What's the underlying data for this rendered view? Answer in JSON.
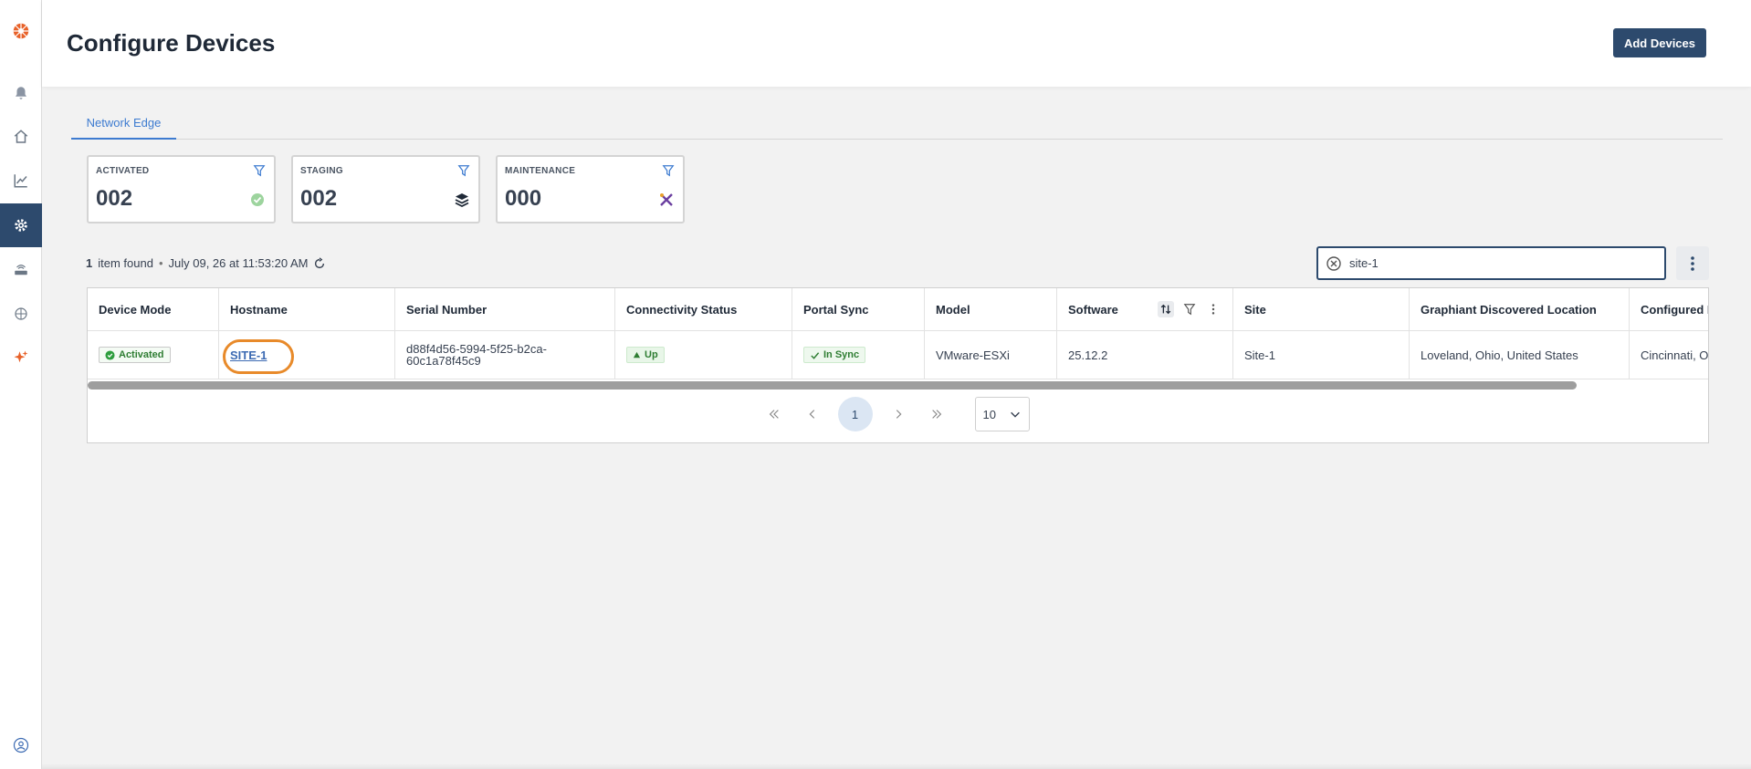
{
  "header": {
    "title": "Configure Devices",
    "add_button": "Add Devices"
  },
  "tabs": [
    {
      "label": "Network Edge",
      "active": true
    }
  ],
  "cards": [
    {
      "label": "ACTIVATED",
      "value": "002",
      "icon": "check-circle-icon"
    },
    {
      "label": "STAGING",
      "value": "002",
      "icon": "layers-icon"
    },
    {
      "label": "MAINTENANCE",
      "value": "000",
      "icon": "tools-icon"
    }
  ],
  "results": {
    "count": "1",
    "suffix": "item found",
    "separator": "•",
    "timestamp": "July 09, 26 at 11:53:20 AM"
  },
  "search": {
    "value": "site-1",
    "placeholder": ""
  },
  "table": {
    "columns": [
      "Device Mode",
      "Hostname",
      "Serial Number",
      "Connectivity Status",
      "Portal Sync",
      "Model",
      "Software",
      "Site",
      "Graphiant Discovered Location",
      "Configured L"
    ],
    "rows": [
      {
        "device_mode": "Activated",
        "hostname": "SITE-1",
        "serial": "d88f4d56-5994-5f25-b2ca-60c1a78f45c9",
        "connectivity": "Up",
        "portal_sync": "In Sync",
        "model": "VMware-ESXi",
        "software": "25.12.2",
        "site": "Site-1",
        "discovered_location": "Loveland, Ohio, United States",
        "configured_location": "Cincinnati, O"
      }
    ]
  },
  "pagination": {
    "current_page": "1",
    "page_size": "10"
  },
  "colors": {
    "primary": "#2d4a6d",
    "accent": "#3d7bd0",
    "highlight_ring": "#e88a2a",
    "success": "#2e7d32"
  }
}
